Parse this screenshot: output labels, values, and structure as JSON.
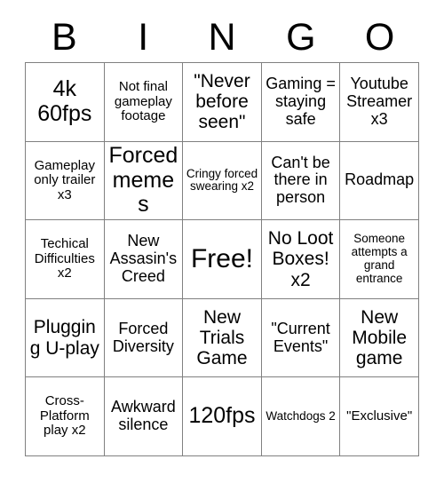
{
  "card": {
    "title": "BINGO",
    "background_color": "#ffffff",
    "text_color": "#000000",
    "border_color": "#808080",
    "columns": 5,
    "rows": 5,
    "header": [
      "B",
      "I",
      "N",
      "G",
      "O"
    ],
    "free_space": {
      "label": "Free!",
      "row": 3,
      "column": 3
    },
    "cells": [
      [
        {
          "text": "4k 60fps",
          "size": "xl"
        },
        {
          "text": "Not final gameplay footage",
          "size": "s"
        },
        {
          "text": "\"Never before seen\"",
          "size": "l"
        },
        {
          "text": "Gaming = staying safe",
          "size": "m"
        },
        {
          "text": "Youtube Streamer x3",
          "size": "m"
        }
      ],
      [
        {
          "text": "Gameplay only trailer x3",
          "size": "s"
        },
        {
          "text": "Forced memes",
          "size": "xl"
        },
        {
          "text": "Cringy forced swearing x2",
          "size": "xs"
        },
        {
          "text": "Can't be there in person",
          "size": "m"
        },
        {
          "text": "Roadmap",
          "size": "m"
        }
      ],
      [
        {
          "text": "Techical Difficulties x2",
          "size": "s"
        },
        {
          "text": "New Assasin's Creed",
          "size": "m"
        },
        {
          "text": "Free!",
          "size": "xxl"
        },
        {
          "text": "No Loot Boxes! x2",
          "size": "l"
        },
        {
          "text": "Someone attempts a grand entrance",
          "size": "xs"
        }
      ],
      [
        {
          "text": "Plugging U-play",
          "size": "l"
        },
        {
          "text": "Forced Diversity",
          "size": "m"
        },
        {
          "text": "New Trials Game",
          "size": "l"
        },
        {
          "text": "\"Current Events\"",
          "size": "m"
        },
        {
          "text": "New Mobile game",
          "size": "l"
        }
      ],
      [
        {
          "text": "Cross-Platform play x2",
          "size": "s"
        },
        {
          "text": "Awkward silence",
          "size": "m"
        },
        {
          "text": "120fps",
          "size": "xl"
        },
        {
          "text": "Watchdogs 2",
          "size": "xs"
        },
        {
          "text": "\"Exclusive\"",
          "size": "s"
        }
      ]
    ]
  }
}
